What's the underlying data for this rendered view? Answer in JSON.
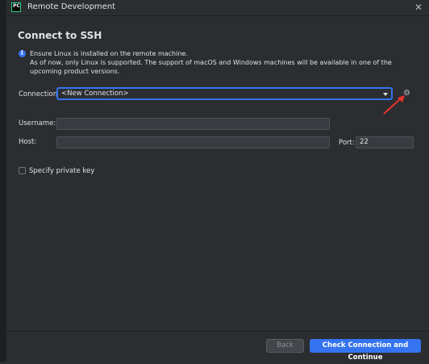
{
  "window": {
    "title": "Remote Development",
    "app_icon_text": "PC"
  },
  "page": {
    "heading": "Connect to SSH",
    "info_line1": "Ensure Linux is installed on the remote machine.",
    "info_line2": "As of now, only Linux is supported. The support of macOS and Windows machines will be available in one of the upcoming product versions."
  },
  "connection": {
    "label": "Connection:",
    "value": "<New Connection>"
  },
  "username": {
    "label": "Username:",
    "value": ""
  },
  "host": {
    "label": "Host:",
    "value": ""
  },
  "port": {
    "label": "Port:",
    "value": "22"
  },
  "private_key": {
    "label": "Specify private key",
    "checked": false
  },
  "footer": {
    "back_label": "Back",
    "continue_label": "Check Connection and Continue"
  },
  "colors": {
    "accent": "#3574f0",
    "annotation_arrow": "#e8352a"
  },
  "icons": [
    "info-icon",
    "gear-icon",
    "close-icon",
    "chevron-down-icon"
  ]
}
